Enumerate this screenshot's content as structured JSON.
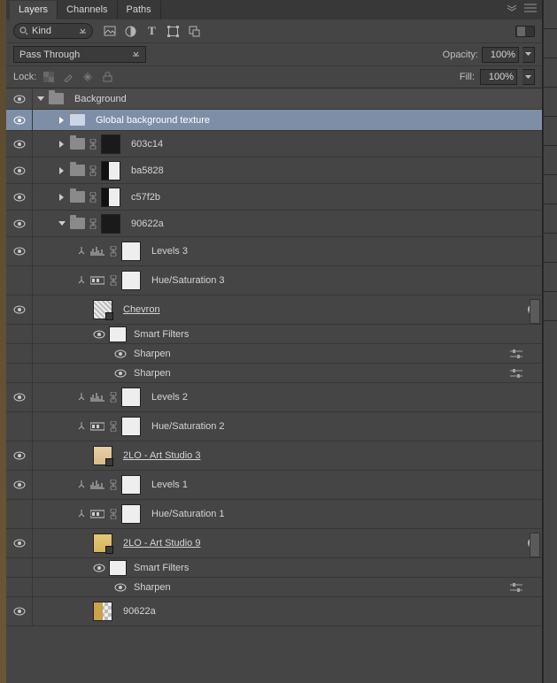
{
  "tabs": {
    "t0": "Layers",
    "t1": "Channels",
    "t2": "Paths"
  },
  "search": {
    "label": "Kind"
  },
  "blend": {
    "mode": "Pass Through",
    "opacity_label": "Opacity:",
    "opacity": "100%"
  },
  "lock": {
    "label": "Lock:",
    "fill_label": "Fill:",
    "fill": "100%"
  },
  "filters": {
    "smart": "Smart Filters",
    "sharpen": "Sharpen"
  },
  "layers": {
    "g0": "Background",
    "g1": "Global background texture",
    "l1": "603c14",
    "l2": "ba5828",
    "l3": "c57f2b",
    "l4": "90622a",
    "a1": "Levels 3",
    "a2": "Hue/Saturation 3",
    "s1": "Chevron ",
    "a3": "Levels 2",
    "a4": "Hue/Saturation 2",
    "s2": "2LO - Art Studio 3 ",
    "a5": "Levels 1",
    "a6": "Hue/Saturation 1",
    "s3": "2LO - Art Studio 9 ",
    "l5": "90622a"
  }
}
